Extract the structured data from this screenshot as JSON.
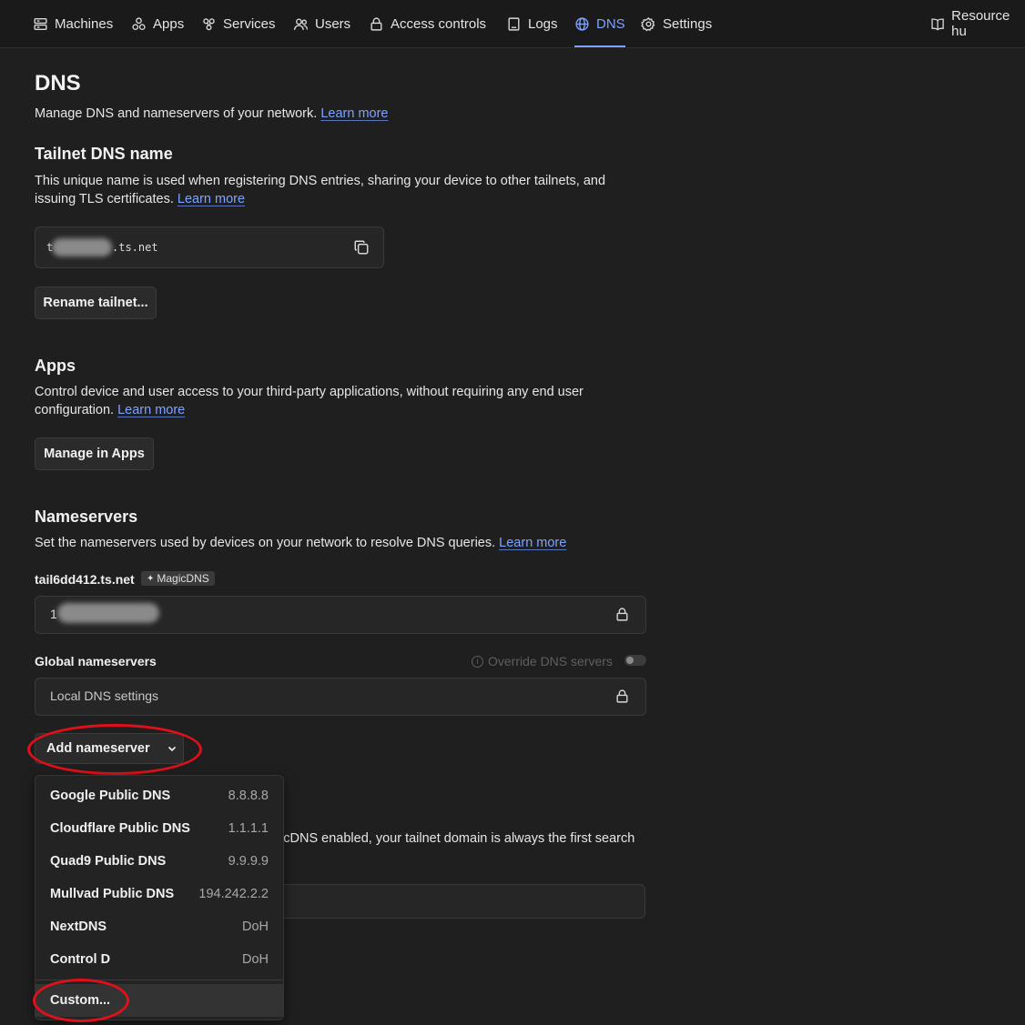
{
  "nav": {
    "items": [
      {
        "label": "Machines",
        "icon": "server-icon"
      },
      {
        "label": "Apps",
        "icon": "apps-icon"
      },
      {
        "label": "Services",
        "icon": "services-icon"
      },
      {
        "label": "Users",
        "icon": "users-icon"
      },
      {
        "label": "Access controls",
        "icon": "lock-icon"
      },
      {
        "label": "Logs",
        "icon": "logs-icon"
      },
      {
        "label": "DNS",
        "icon": "globe-icon"
      },
      {
        "label": "Settings",
        "icon": "gear-icon"
      }
    ],
    "active": "DNS",
    "resource_hub": "Resource hu"
  },
  "page": {
    "title": "DNS",
    "subtitle": "Manage DNS and nameservers of your network.",
    "learn_more": "Learn more"
  },
  "tailnet": {
    "heading": "Tailnet DNS name",
    "desc_line1": "This unique name is used when registering DNS entries, sharing your device to other tailnets, and",
    "desc_line2": "issuing TLS certificates.",
    "learn_more": "Learn more",
    "name_prefix": "t",
    "name_suffix": ".ts.net",
    "rename_button": "Rename tailnet..."
  },
  "apps": {
    "heading": "Apps",
    "desc_line1": "Control device and user access to your third-party applications, without requiring any end user",
    "desc_line2": "configuration.",
    "learn_more": "Learn more",
    "manage_button": "Manage in Apps"
  },
  "nameservers": {
    "heading": "Nameservers",
    "desc": "Set the nameservers used by devices on your network to resolve DNS queries.",
    "learn_more": "Learn more",
    "tailnet_name": "tail6dd412.ts.net",
    "magic_badge": "MagicDNS",
    "magic_value_prefix": "1",
    "global_label": "Global nameservers",
    "override_label": "Override DNS servers",
    "override_enabled": false,
    "local_dns": "Local DNS settings",
    "add_button": "Add nameserver",
    "behind_text": "gicDNS enabled, your tailnet domain is always the first search"
  },
  "menu": {
    "items": [
      {
        "name": "Google Public DNS",
        "value": "8.8.8.8"
      },
      {
        "name": "Cloudflare Public DNS",
        "value": "1.1.1.1"
      },
      {
        "name": "Quad9 Public DNS",
        "value": "9.9.9.9"
      },
      {
        "name": "Mullvad Public DNS",
        "value": "194.242.2.2"
      },
      {
        "name": "NextDNS",
        "value": "DoH"
      },
      {
        "name": "Control D",
        "value": "DoH"
      }
    ],
    "custom": "Custom..."
  },
  "colors": {
    "accent": "#7ea2ff",
    "annotation": "#e0101a",
    "background": "#1f1f1f"
  }
}
